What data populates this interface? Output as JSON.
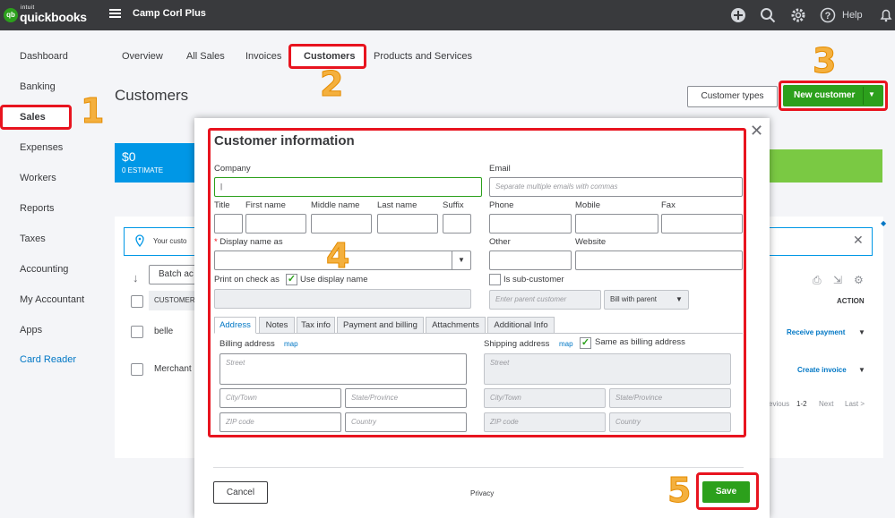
{
  "brand": {
    "intuit": "intuit",
    "name": "quickbooks",
    "logo": "qb"
  },
  "company": "Camp Corl Plus",
  "topbar": {
    "help": "Help",
    "icons": [
      "plus-icon",
      "search-icon",
      "gear-icon",
      "help-icon",
      "bell-icon"
    ]
  },
  "sidebar": {
    "items": [
      {
        "label": "Dashboard"
      },
      {
        "label": "Banking"
      },
      {
        "label": "Sales"
      },
      {
        "label": "Expenses"
      },
      {
        "label": "Workers"
      },
      {
        "label": "Reports"
      },
      {
        "label": "Taxes"
      },
      {
        "label": "Accounting"
      },
      {
        "label": "My Accountant"
      },
      {
        "label": "Apps"
      },
      {
        "label": "Card Reader"
      }
    ]
  },
  "tabs": [
    "Overview",
    "All Sales",
    "Invoices",
    "Customers",
    "Products and Services"
  ],
  "page_title": "Customers",
  "buttons": {
    "customer_types": "Customer types",
    "new_customer": "New customer",
    "batch": "Batch ac"
  },
  "money_bar": {
    "amount": "$0",
    "label": "0 ESTIMATE"
  },
  "info_text": "Your custo",
  "table": {
    "column": "CUSTOMER",
    "action_header": "ACTION",
    "rows": [
      {
        "name": "belle",
        "action": "Receive payment"
      },
      {
        "name": "Merchant",
        "action": "Create invoice"
      }
    ],
    "pager": {
      "previous": "evious",
      "range": "1-2",
      "next": "Next",
      "last": "Last >"
    }
  },
  "modal": {
    "title": "Customer information",
    "company_label": "Company",
    "email_label": "Email",
    "email_placeholder": "Separate multiple emails with commas",
    "name_labels": {
      "title": "Title",
      "first": "First name",
      "middle": "Middle name",
      "last": "Last name",
      "suffix": "Suffix"
    },
    "phone_labels": {
      "phone": "Phone",
      "mobile": "Mobile",
      "fax": "Fax"
    },
    "display_name_label": "Display name as",
    "required_mark": "*",
    "other_label": "Other",
    "website_label": "Website",
    "print_check_label": "Print on check as",
    "use_display_name": "Use display name",
    "sub_customer": "Is sub-customer",
    "parent_placeholder": "Enter parent customer",
    "bill_with_parent": "Bill with parent",
    "tabs": [
      "Address",
      "Notes",
      "Tax info",
      "Payment and billing",
      "Attachments",
      "Additional Info"
    ],
    "billing_label": "Billing address",
    "shipping_label": "Shipping address",
    "map": "map",
    "same_as_billing": "Same as billing address",
    "placeholders": {
      "street": "Street",
      "city": "City/Town",
      "state": "State/Province",
      "zip": "ZIP code",
      "country": "Country"
    },
    "cancel": "Cancel",
    "privacy": "Privacy",
    "save": "Save"
  },
  "steps": [
    "1",
    "2",
    "3",
    "4",
    "5"
  ],
  "colors": {
    "accent_green": "#2ca01c",
    "highlight_red": "#e8141f",
    "step_orange": "#f4b03e",
    "link_blue": "#0077c5"
  }
}
